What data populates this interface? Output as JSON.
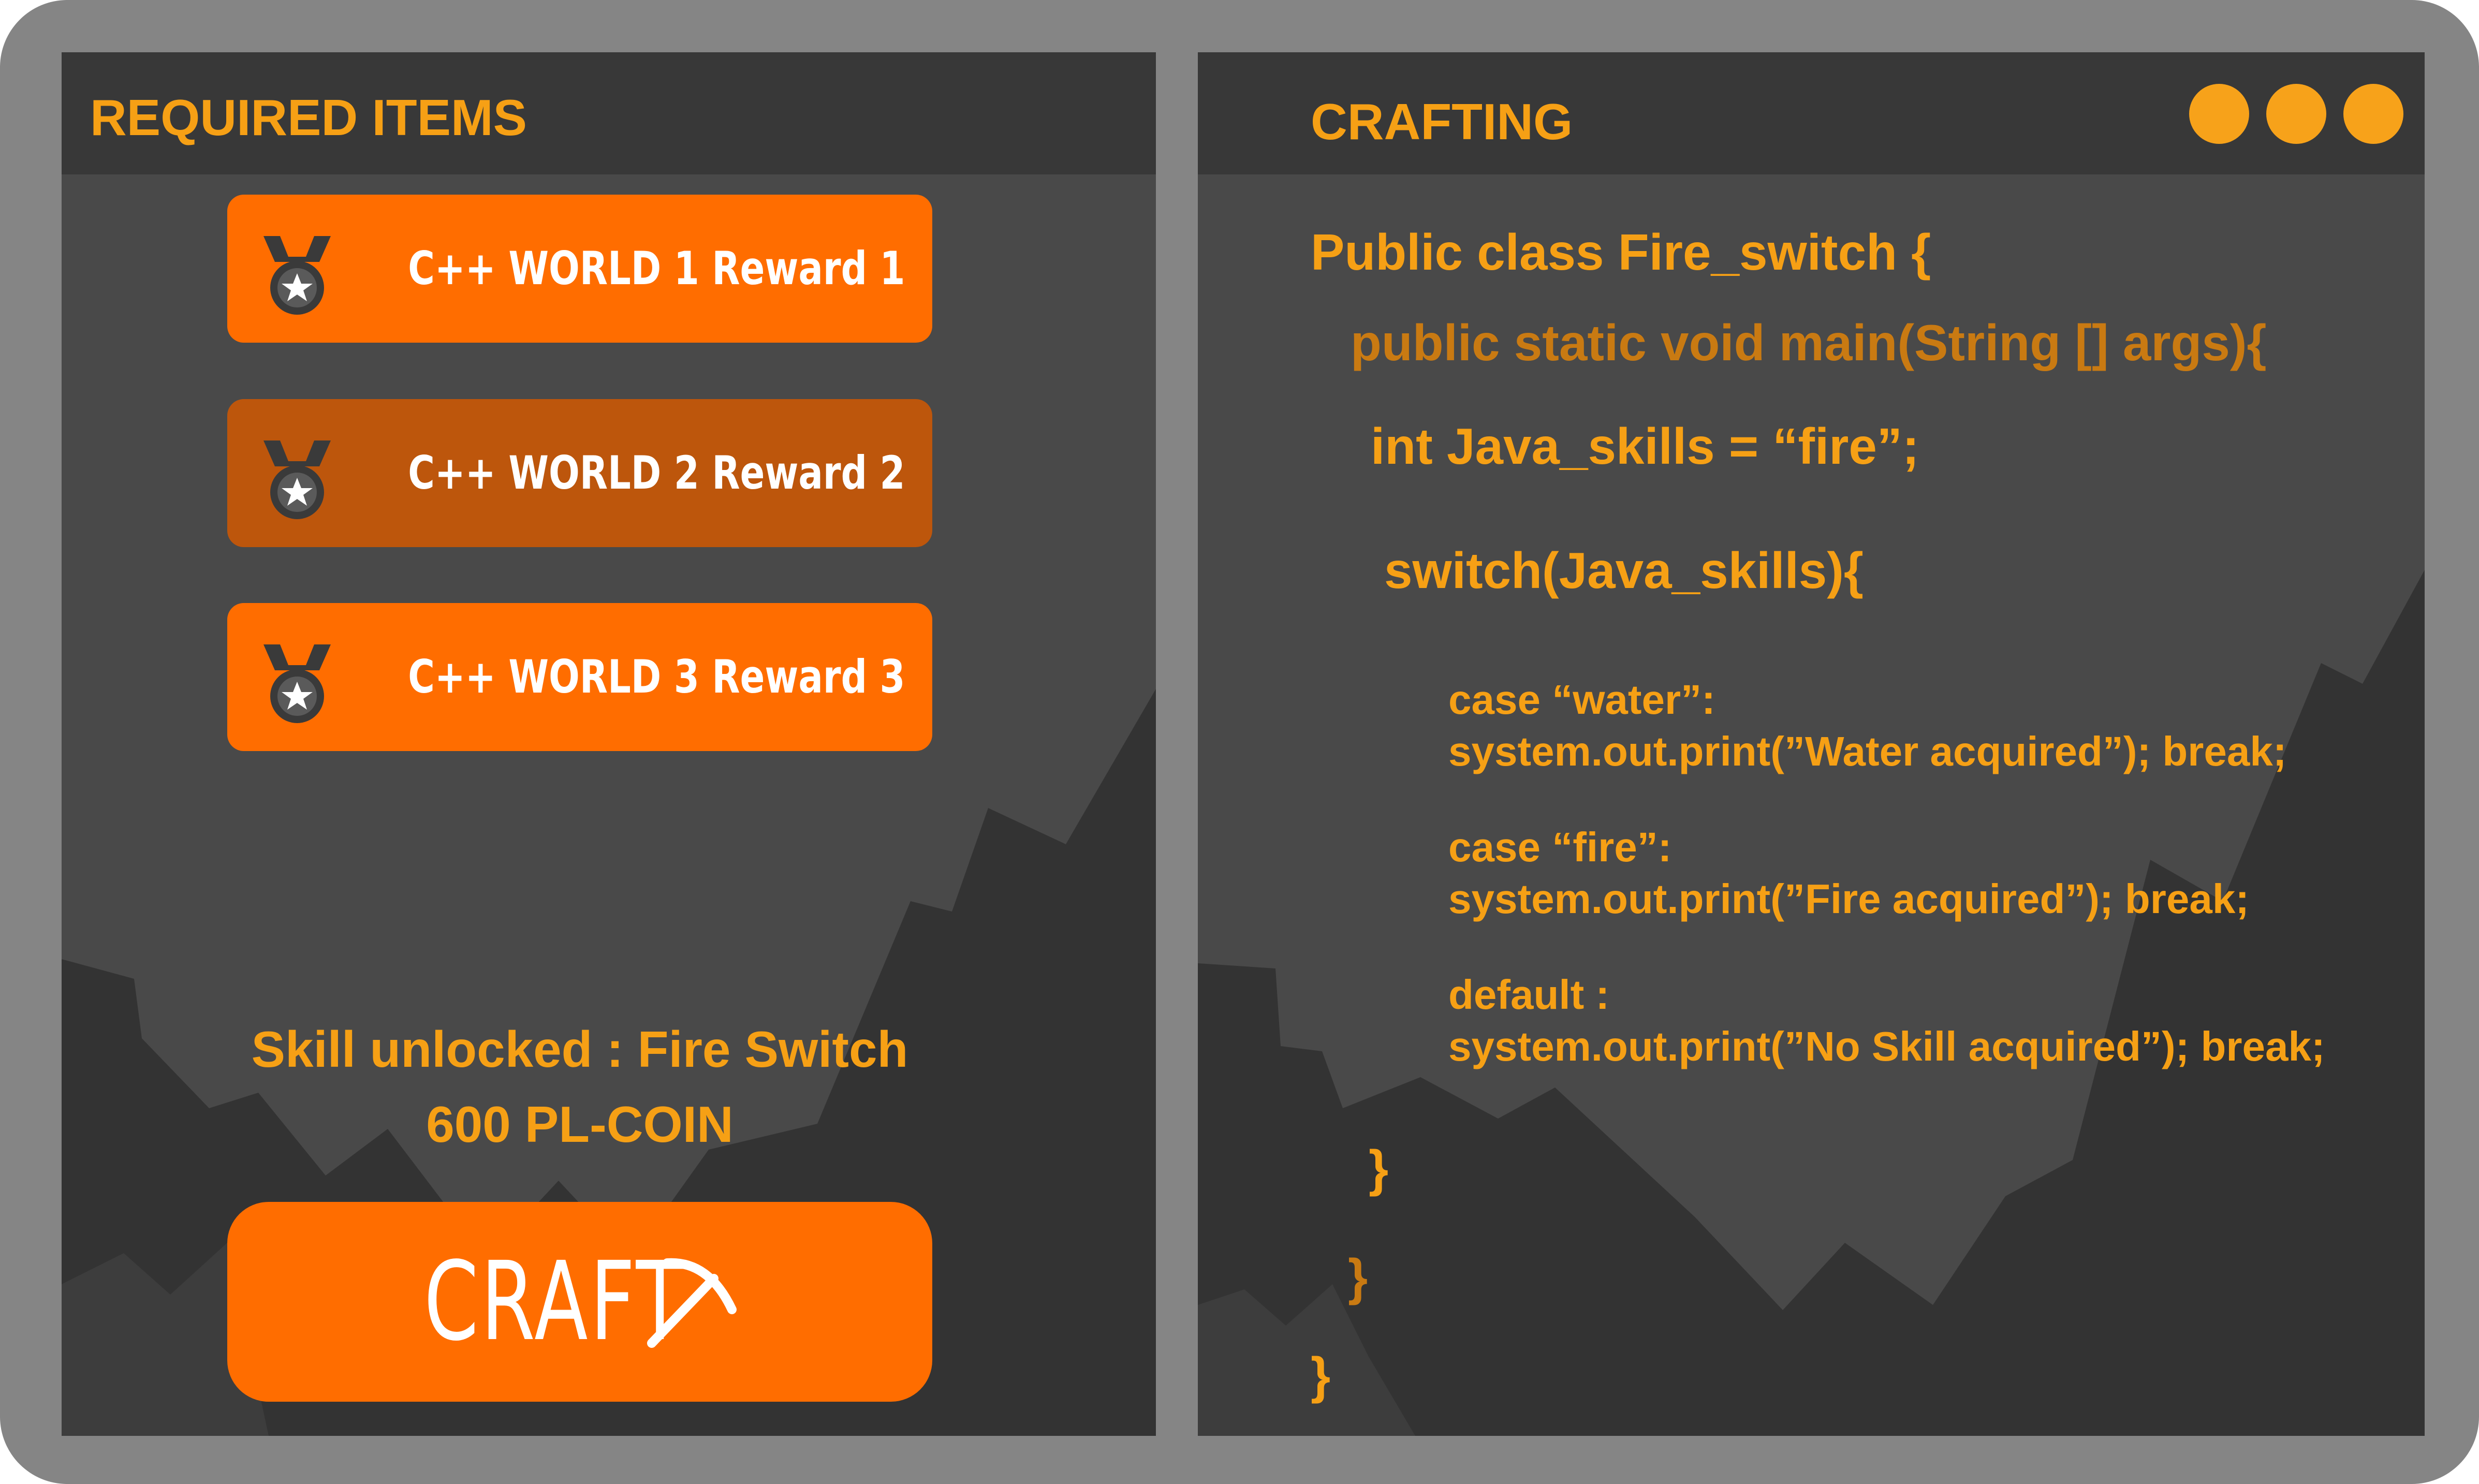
{
  "required_items": {
    "title": "REQUIRED ITEMS",
    "items": [
      {
        "label": "C++ WORLD 1 Reward 1",
        "icon": "medal-icon",
        "selected": false
      },
      {
        "label": "C++ WORLD 2 Reward 2",
        "icon": "medal-icon",
        "selected": true
      },
      {
        "label": "C++ WORLD 3 Reward 3",
        "icon": "medal-icon",
        "selected": false
      }
    ],
    "skill_unlocked": "Skill unlocked : Fire Switch",
    "cost": "600 PL-COIN",
    "craft_label": "CRAFT",
    "craft_icon": "pickaxe-icon"
  },
  "crafting": {
    "title": "CRAFTING",
    "window_controls": [
      "window-dot",
      "window-dot",
      "window-dot"
    ],
    "code_lines": [
      "Public class Fire_switch {",
      "public static void main(String [] args){",
      "int Java_skills = “fire”;",
      "switch(Java_skills){",
      "case “water”:",
      "system.out.print(”Water acquired”); break;",
      "case “fire”:",
      "system.out.print(”Fire acquired”); break;",
      "default :",
      "system.out.print(”No Skill acquired”); break;",
      "}",
      "}",
      "}"
    ]
  },
  "colors": {
    "frame": "#858585",
    "panel": "#494949",
    "titlebar": "#383838",
    "mountain": "#333333",
    "accent_text": "#F6A015",
    "button": "#FF6D00",
    "button_selected": "#BD560C",
    "dot": "#F7A21A"
  }
}
